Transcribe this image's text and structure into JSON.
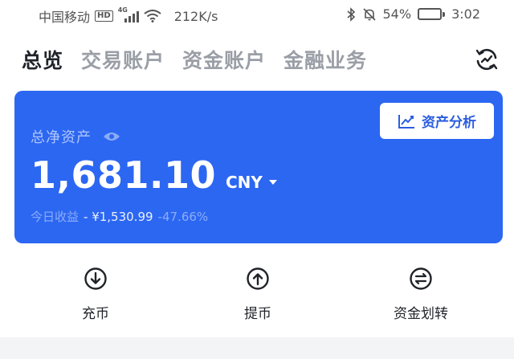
{
  "status_bar": {
    "carrier": "中国移动",
    "hd": "HD",
    "network": "4G",
    "speed": "212K/s",
    "battery_percent": "54%",
    "battery_level": 0.54,
    "time": "3:02"
  },
  "tabs": [
    {
      "label": "总览",
      "active": true
    },
    {
      "label": "交易账户",
      "active": false
    },
    {
      "label": "资金账户",
      "active": false
    },
    {
      "label": "金融业务",
      "active": false
    }
  ],
  "card": {
    "label": "总净资产",
    "amount": "1,681.10",
    "currency": "CNY",
    "analysis_button": "资产分析",
    "today_label": "今日收益",
    "today_amount": "- ¥1,530.99",
    "today_percent": "-47.66%",
    "background_color": "#2c67f2"
  },
  "actions": [
    {
      "label": "充币",
      "icon": "download-icon"
    },
    {
      "label": "提币",
      "icon": "upload-icon"
    },
    {
      "label": "资金划转",
      "icon": "transfer-icon"
    }
  ]
}
